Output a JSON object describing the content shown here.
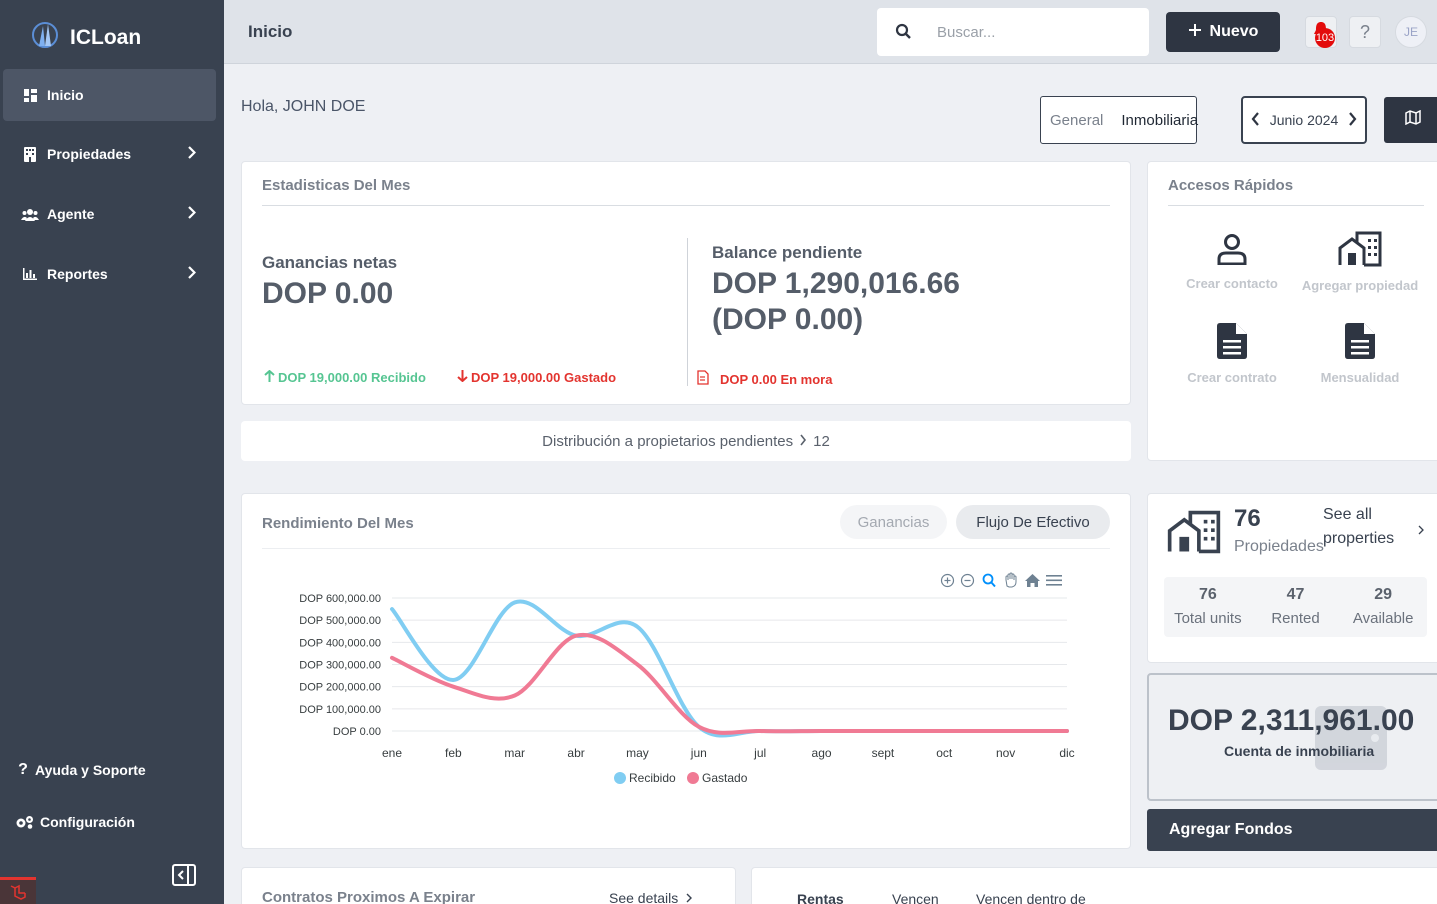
{
  "app": {
    "name": "ICLoan"
  },
  "sidebar": {
    "items": [
      {
        "label": "Inicio",
        "icon": "dashboard-icon",
        "active": true
      },
      {
        "label": "Propiedades",
        "icon": "building-icon"
      },
      {
        "label": "Agente",
        "icon": "users-icon"
      },
      {
        "label": "Reportes",
        "icon": "chart-bar-icon"
      }
    ],
    "footer": [
      {
        "label": "Ayuda y Soporte",
        "icon": "question-icon"
      },
      {
        "label": "Configuración",
        "icon": "gears-icon"
      }
    ]
  },
  "header": {
    "title": "Inicio",
    "search_placeholder": "Buscar...",
    "new_label": "Nuevo",
    "notifications": "103",
    "help": "?",
    "avatar": "JE"
  },
  "greeting": "Hola, JOHN DOE",
  "view_toggle": {
    "options": [
      "General",
      "Inmobiliaria"
    ],
    "selected": "Inmobiliaria"
  },
  "month": "Junio 2024",
  "stats": {
    "title": "Estadisticas Del Mes",
    "net_label": "Ganancias netas",
    "net_value": "DOP 0.00",
    "received": "DOP 19,000.00 Recibido",
    "spent": "DOP 19,000.00 Gastado",
    "balance_label": "Balance pendiente",
    "balance_value": "DOP 1,290,016.66",
    "balance_sub": "(DOP 0.00)",
    "overdue": "DOP 0.00 En mora"
  },
  "distribution": {
    "label": "Distribución a propietarios pendientes",
    "count": "12"
  },
  "quick_access": {
    "title": "Accesos Rápidos",
    "items": [
      {
        "label": "Crear contacto",
        "icon": "user-icon"
      },
      {
        "label": "Agregar propiedad",
        "icon": "building-icon"
      },
      {
        "label": "Crear contrato",
        "icon": "file-icon"
      },
      {
        "label": "Mensualidad",
        "icon": "file-icon"
      }
    ]
  },
  "performance": {
    "title": "Rendimiento Del Mes",
    "tabs": [
      "Ganancias",
      "Flujo De Efectivo"
    ],
    "selected_tab": "Flujo De Efectivo"
  },
  "properties": {
    "count": "76",
    "label": "Propiedades",
    "see_all": "See all properties",
    "units": [
      {
        "value": "76",
        "label": "Total units"
      },
      {
        "value": "47",
        "label": "Rented"
      },
      {
        "value": "29",
        "label": "Available"
      }
    ]
  },
  "account": {
    "balance": "DOP 2,311,961.00",
    "label": "Cuenta de inmobiliaria",
    "add_funds": "Agregar Fondos"
  },
  "contracts": {
    "title": "Contratos Proximos A Expirar",
    "see_details": "See details"
  },
  "rent_tabs": [
    "Rentas",
    "Vencen",
    "Vencen dentro de"
  ],
  "colors": {
    "sidebar": "#394250",
    "accent_dark": "#2e3542",
    "received": "#56c592",
    "spent": "#e3342f",
    "series_received": "#80cdf2",
    "series_spent": "#f07a94"
  },
  "chart_data": {
    "type": "line",
    "categories": [
      "ene",
      "feb",
      "mar",
      "abr",
      "may",
      "jun",
      "jul",
      "ago",
      "sept",
      "oct",
      "nov",
      "dic"
    ],
    "series": [
      {
        "name": "Recibido",
        "color": "#80cdf2",
        "values": [
          550000,
          230000,
          580000,
          430000,
          470000,
          19000,
          0,
          0,
          0,
          0,
          0,
          0
        ]
      },
      {
        "name": "Gastado",
        "color": "#f07a94",
        "values": [
          330000,
          200000,
          160000,
          430000,
          300000,
          19000,
          0,
          0,
          0,
          0,
          0,
          0
        ]
      }
    ],
    "y_ticks": [
      "DOP 600,000.00",
      "DOP 500,000.00",
      "DOP 400,000.00",
      "DOP 300,000.00",
      "DOP 200,000.00",
      "DOP 100,000.00",
      "DOP 0.00"
    ],
    "ylim": [
      0,
      600000
    ],
    "legend": "bottom",
    "grid": true
  }
}
